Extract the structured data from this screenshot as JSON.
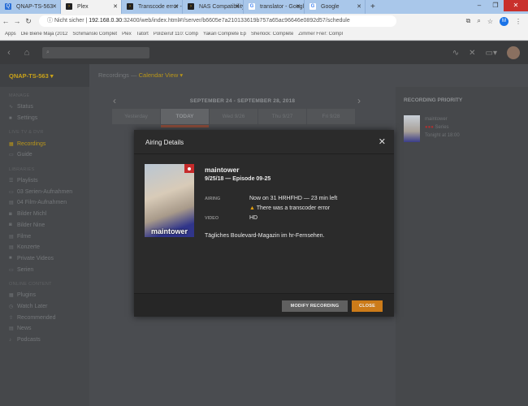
{
  "browser": {
    "tabs": [
      {
        "label": "QNAP-TS-563",
        "icon": "qnap"
      },
      {
        "label": "Plex",
        "icon": "plex",
        "active": true
      },
      {
        "label": "Transcode error - Ple",
        "icon": "plex"
      },
      {
        "label": "NAS Compatibility Li",
        "icon": "plex"
      },
      {
        "label": "translator - Google-S",
        "icon": "google"
      },
      {
        "label": "Google",
        "icon": "google"
      }
    ],
    "security": "Nicht sicher",
    "url_host": "192.168.0.30",
    "url_rest": ":32400/web/index.html#!/server/b6605e7a210133619b757a65ac96646e0892d57/schedule",
    "profile": "M",
    "bookmarks": [
      "Apps",
      "Die Biene Maja (2012",
      "Schimanski Complet",
      "Plex",
      "Tatort",
      "Polizeiruf 110: Comp",
      "Yakari Complete Ep",
      "Sherlock: Complete",
      "Zimmer Frei!: Compl"
    ]
  },
  "sidebar": {
    "server": "QNAP-TS-563 ▾",
    "sections": [
      {
        "title": "Manage",
        "items": [
          {
            "label": "Status",
            "icon": "activity-icon"
          },
          {
            "label": "Settings",
            "icon": "settings-icon"
          }
        ]
      },
      {
        "title": "Live TV & DVR",
        "items": [
          {
            "label": "Recordings",
            "icon": "calendar-icon",
            "active": true
          },
          {
            "label": "Guide",
            "icon": "tv-icon"
          }
        ]
      },
      {
        "title": "Libraries",
        "items": [
          {
            "label": "Playlists",
            "icon": "playlist-icon"
          },
          {
            "label": "03 Serien-Aufnahmen",
            "icon": "tv-icon"
          },
          {
            "label": "04 Film-Aufnahmen",
            "icon": "film-icon"
          },
          {
            "label": "Bilder Michl",
            "icon": "camera-icon"
          },
          {
            "label": "Bilder Nine",
            "icon": "camera-icon"
          },
          {
            "label": "Filme",
            "icon": "film-icon"
          },
          {
            "label": "Konzerte",
            "icon": "film-icon"
          },
          {
            "label": "Private Videos",
            "icon": "video-icon"
          },
          {
            "label": "Serien",
            "icon": "tv-icon"
          }
        ]
      },
      {
        "title": "Online Content",
        "items": [
          {
            "label": "Plugins",
            "icon": "grid-icon"
          },
          {
            "label": "Watch Later",
            "icon": "clock-icon"
          },
          {
            "label": "Recommended",
            "icon": "share-icon"
          },
          {
            "label": "News",
            "icon": "news-icon"
          },
          {
            "label": "Podcasts",
            "icon": "mic-icon"
          }
        ]
      }
    ]
  },
  "header": {
    "section": "Recordings —",
    "view": "Calendar View ▾"
  },
  "calendar": {
    "week": "SEPTEMBER 24 - SEPTEMBER 28, 2018",
    "days": [
      "Yesterday",
      "TODAY",
      "Wed 9/26",
      "Thu 9/27",
      "Fri 9/28"
    ]
  },
  "priority": {
    "title": "RECORDING PRIORITY",
    "item": {
      "title": "maintower",
      "type": "Series",
      "time": "Tonight at 18:00"
    }
  },
  "modal": {
    "title": "Airing Details",
    "show": "maintower",
    "poster_text": "maintower",
    "episode": "9/25/18 — Episode 09-25",
    "airing_label": "AIRING",
    "airing": "Now on 31 HRHFHD — 23 min left",
    "warning": "There was a transcoder error",
    "video_label": "VIDEO",
    "video": "HD",
    "description": "Tägliches Boulevard-Magazin im hr-Fernsehen.",
    "modify": "MODIFY RECORDING",
    "close": "CLOSE"
  },
  "colors": {
    "accent": "#cc7b19",
    "active": "#e5a00d",
    "record": "#c62b2b"
  }
}
